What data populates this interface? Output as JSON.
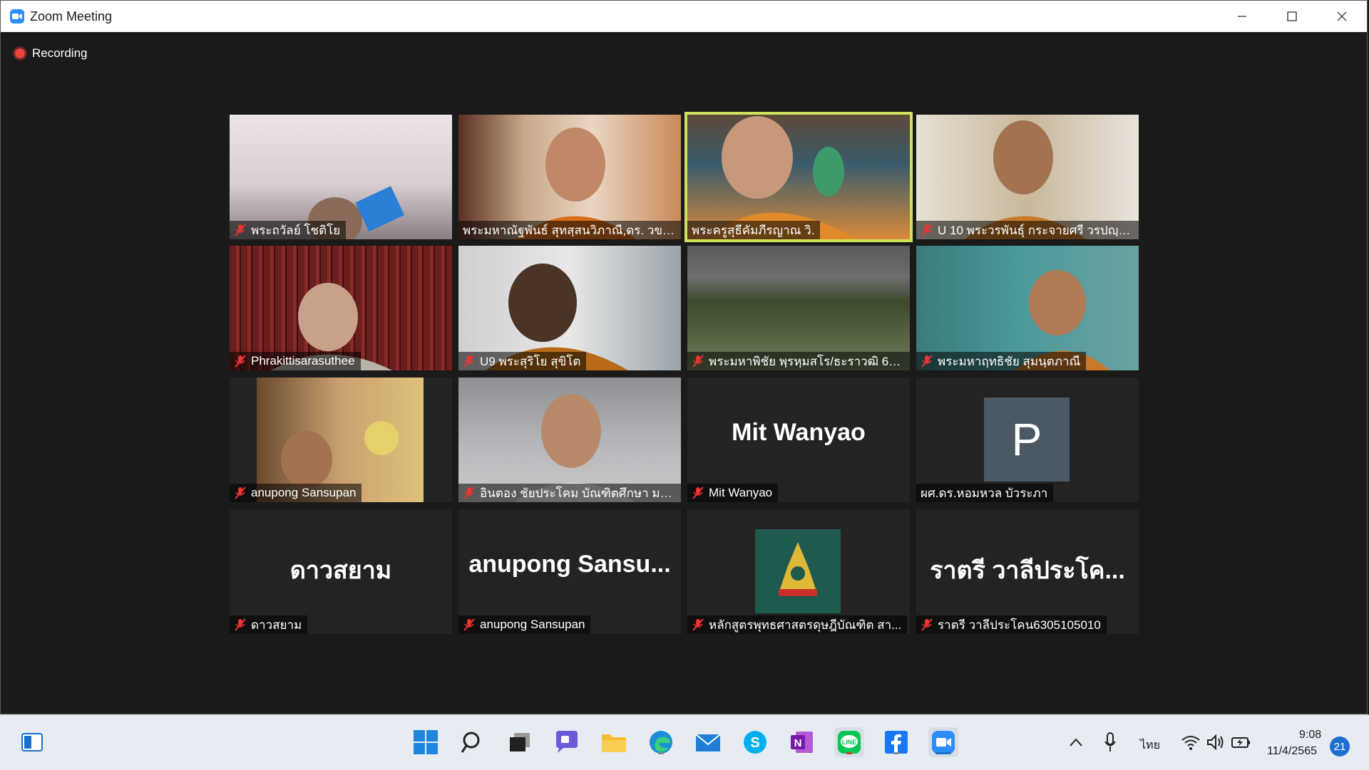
{
  "window": {
    "title": "Zoom Meeting"
  },
  "recording": {
    "label": "Recording"
  },
  "participants": [
    {
      "name": "พระถวัลย์ โชติโย",
      "big": ""
    },
    {
      "name": "พระมหาณัฐพันธ์ สุทสฺสนวิภาณี,ดร. วข.ข...",
      "big": ""
    },
    {
      "name": "พระครูสุธีคัมภีรญาณ วิ.",
      "big": ""
    },
    {
      "name": "U 10 พระวรพันธุ์ กระจายศรี วรปญฺโญ",
      "big": ""
    },
    {
      "name": "Phrakittisarasuthee",
      "big": ""
    },
    {
      "name": "U9 พระสุริโย สุขิโต",
      "big": ""
    },
    {
      "name": "พระมหาพิชัย พฺรหฺมสโร/ธะราวฒิ 63...",
      "big": ""
    },
    {
      "name": "พระมหาฤทธิชัย สุมนฺตภาณี",
      "big": ""
    },
    {
      "name": "anupong Sansupan",
      "big": ""
    },
    {
      "name": "อินตอง ชัยประโคม บัณฑิตศึกษา มจ...",
      "big": ""
    },
    {
      "name": "Mit Wanyao",
      "big": "Mit Wanyao"
    },
    {
      "name": "ผศ.ดร.หอมหวล บัวระภา",
      "big": "",
      "avatar_letter": "P"
    },
    {
      "name": "ดาวสยาม",
      "big": "ดาวสยาม"
    },
    {
      "name": "anupong Sansupan",
      "big": "anupong Sansu..."
    },
    {
      "name": "หลักสูตรพุทธศาสตรดุษฎีบัณฑิต สา...",
      "big": ""
    },
    {
      "name": "ราตรี วาลีประโคน6305105010",
      "big": "ราตรี วาลีประโค..."
    }
  ],
  "taskbar": {
    "language": "ไทย",
    "time": "9:08",
    "date": "11/4/2565",
    "notification_count": "21",
    "apps": [
      "start-icon",
      "search-icon",
      "task-view-icon",
      "teams-chat-icon",
      "file-explorer-icon",
      "edge-icon",
      "mail-icon",
      "skype-icon",
      "onenote-icon",
      "line-icon",
      "facebook-icon",
      "zoom-icon"
    ]
  },
  "colors": {
    "active_speaker_border": "#cfe15a",
    "zoom_blue": "#2d8cff",
    "recording_red": "#e8433b"
  }
}
